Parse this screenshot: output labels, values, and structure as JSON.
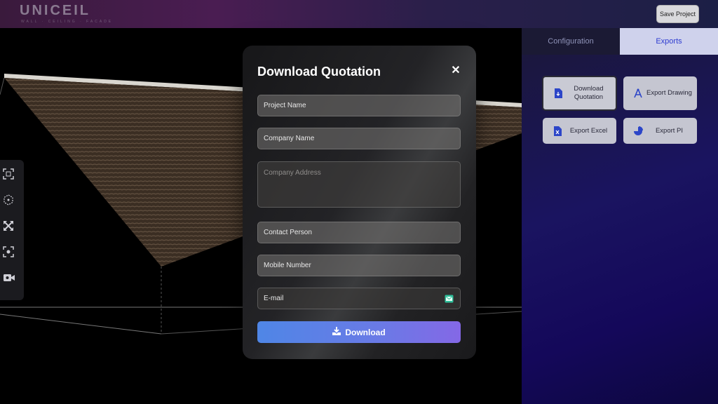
{
  "header": {
    "logo_text": "UNICEIL",
    "logo_tagline": "WALL · CEILING · FACADE",
    "save_label": "Save Project"
  },
  "sidebar": {
    "tabs": [
      {
        "label": "Configuration",
        "active": false
      },
      {
        "label": "Exports",
        "active": true
      }
    ],
    "exports": [
      {
        "label": "Download Quotation",
        "icon": "document-icon",
        "active": true
      },
      {
        "label": "Export Drawing",
        "icon": "compass-icon",
        "active": false
      },
      {
        "label": "Export Excel",
        "icon": "excel-icon",
        "active": false
      },
      {
        "label": "Export PI",
        "icon": "pie-chart-icon",
        "active": false
      }
    ]
  },
  "toolbar": {
    "tools": [
      "fit-view-icon",
      "cube-view-icon",
      "expand-icon",
      "focus-icon",
      "camera-icon"
    ]
  },
  "modal": {
    "title": "Download Quotation",
    "close_glyph": "✕",
    "fields": {
      "project_name": "Project Name",
      "company_name": "Company Name",
      "company_address": "Company Address",
      "contact_person": "Contact Person",
      "mobile_number": "Mobile Number",
      "email": "E-mail"
    },
    "download_label": "Download"
  },
  "colors": {
    "accent": "#2d3bd0",
    "download_start": "#4f86e6",
    "download_end": "#8468e6"
  }
}
